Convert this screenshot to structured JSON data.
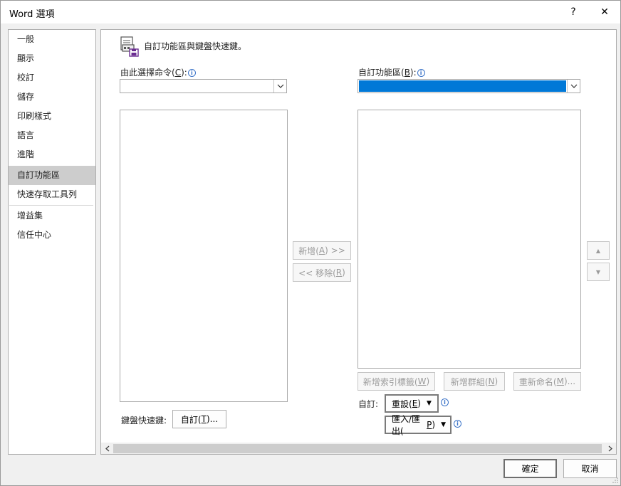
{
  "window": {
    "title": "Word 選項",
    "help": "?",
    "close": "✕"
  },
  "sidebar": {
    "items": [
      {
        "label": "一般"
      },
      {
        "label": "顯示"
      },
      {
        "label": "校訂"
      },
      {
        "label": "儲存"
      },
      {
        "label": "印刷樣式"
      },
      {
        "label": "語言"
      },
      {
        "label": "進階"
      },
      {
        "label": "自訂功能區",
        "selected": true
      },
      {
        "label": "快速存取工具列"
      },
      {
        "label": "增益集"
      },
      {
        "label": "信任中心"
      }
    ]
  },
  "main": {
    "header": "自訂功能區與鍵盤快速鍵。",
    "choose_commands": {
      "label": "由此選擇命令(",
      "key": "C",
      "suffix": "):"
    },
    "customize_ribbon": {
      "label": "自訂功能區(",
      "key": "B",
      "suffix": "):"
    },
    "add_button": {
      "label": "新增(",
      "key": "A",
      "suffix": ") >>"
    },
    "remove_button": {
      "label": "<< 移除(",
      "key": "R",
      "suffix": ")"
    },
    "new_tab_button": {
      "label": "新增索引標籤(",
      "key": "W",
      "suffix": ")"
    },
    "new_group_button": {
      "label": "新增群組(",
      "key": "N",
      "suffix": ")"
    },
    "rename_button": {
      "label": "重新命名(",
      "key": "M",
      "suffix": ")..."
    },
    "customizations_label": "自訂:",
    "reset_button": {
      "label": "重設(",
      "key": "E",
      "suffix": ")"
    },
    "import_export_button": {
      "label": "匯入/匯出(",
      "key": "P",
      "suffix": ")"
    },
    "keyboard_label": "鍵盤快速鍵:",
    "customize_button": {
      "label": "自訂(",
      "key": "T",
      "suffix": ")..."
    },
    "move_up": "▲",
    "move_down": "▼"
  },
  "footer": {
    "ok": "確定",
    "cancel": "取消"
  },
  "colors": {
    "accent": "#0078d7",
    "selected_nav": "#cdcdcd"
  }
}
